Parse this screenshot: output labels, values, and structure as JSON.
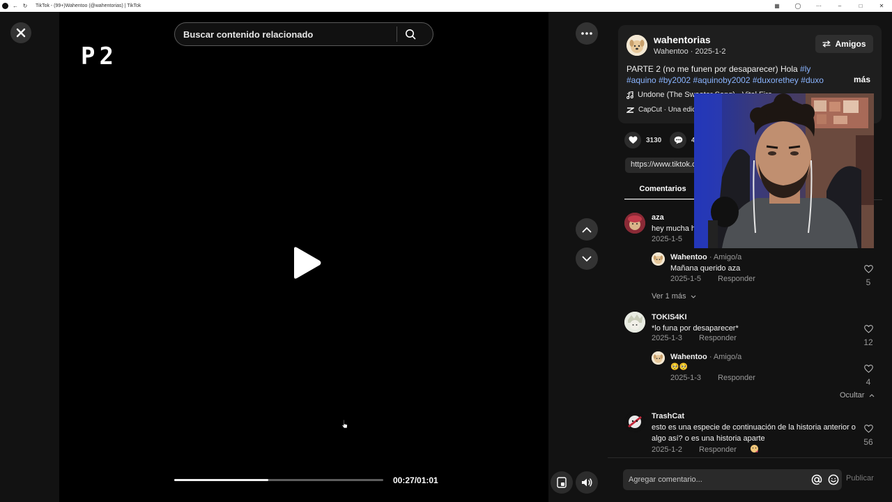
{
  "browser": {
    "tab_title": "TikTok - (99+)Wahentoo (@wahentorias) | TikTok",
    "back_icon": "arrow-left-icon",
    "reload_icon": "reload-icon"
  },
  "player": {
    "search_placeholder": "Buscar contenido relacionado",
    "overlay_text": "P2",
    "current_time": "00:27/01:01",
    "progress_fraction": 0.45
  },
  "post": {
    "author_username": "wahentorias",
    "author_meta": "Wahentoo · 2025-1-2",
    "friends_button": "Amigos",
    "caption_text": "PARTE 2 (no me funen por desaparecer) Hola ",
    "hashtags": [
      "#ly",
      "#aquino",
      "#by2002",
      "#aquinoby2002",
      "#duxorethey",
      "#duxo"
    ],
    "caption_ellipsis": "...",
    "more_label": "más",
    "music": "Undone (The Sweater Song) - Vital Fire",
    "capcut": "CapCut · Una edición",
    "likes": "3130",
    "comments_count": "4",
    "link": "https://www.tiktok.com/@wahentorias/video",
    "tab_comments": "Comentarios"
  },
  "comments": [
    {
      "user": "aza",
      "text": "hey mucha h",
      "date": "2025-1-5",
      "replies": [
        {
          "user": "Wahentoo",
          "badge": "· Amigo/a",
          "text": "Mañana querido aza",
          "date": "2025-1-5",
          "reply": "Responder",
          "likes": "5"
        }
      ],
      "view_more": "Ver 1 más"
    },
    {
      "user": "TOKIS4KI",
      "text": "*lo funa por desaparecer*",
      "date": "2025-1-3",
      "reply": "Responder",
      "likes": "12",
      "replies": [
        {
          "user": "Wahentoo",
          "badge": "· Amigo/a",
          "text": "🥺🥺",
          "date": "2025-1-3",
          "reply": "Responder",
          "likes": "4"
        }
      ],
      "hide": "Ocultar"
    },
    {
      "user": "TrashCat",
      "text": "esto es una especie de continuación de la historia anterior o algo así? o es una historia aparte",
      "date": "2025-1-2",
      "reply": "Responder",
      "likes": "56"
    }
  ],
  "composer": {
    "placeholder": "Agregar comentario...",
    "publish": "Publicar"
  }
}
